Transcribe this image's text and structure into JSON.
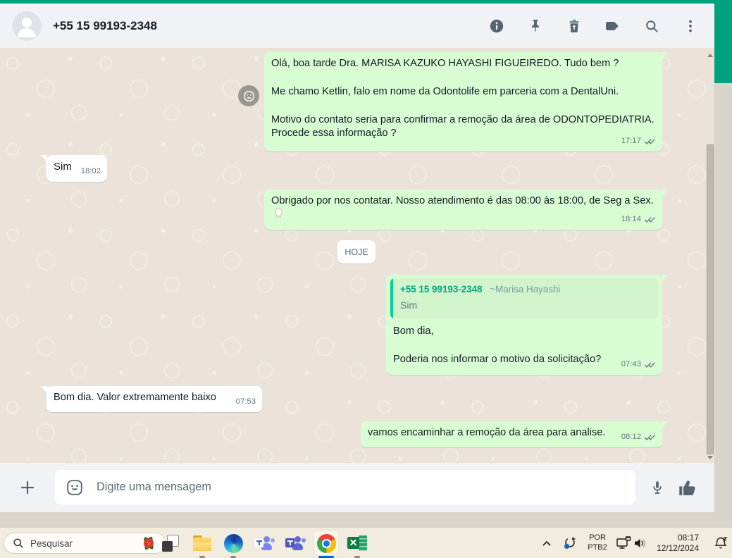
{
  "colors": {
    "accent_teal": "#00a17d",
    "outgoing_bubble": "#d9fdd3",
    "incoming_bubble": "#ffffff",
    "chat_background": "#ebe3d9",
    "panel_background": "#f0f2f5",
    "icon_gray": "#54656f",
    "meta_gray": "#667781",
    "quote_bar": "#06cf9c",
    "quote_author_green": "#00a884",
    "taskbar_background": "#f2ecde",
    "active_app_underline": "#0067c0"
  },
  "header": {
    "title": "+55 15 99193-2348",
    "icons": [
      "info-icon",
      "pin-icon",
      "delete-icon",
      "label-icon",
      "search-icon",
      "menu-icon"
    ]
  },
  "chat": {
    "date_divider": "HOJE",
    "messages": [
      {
        "direction": "out",
        "lines": [
          "Olá, boa tarde Dra. MARISA KAZUKO HAYASHI FIGUEIREDO. Tudo bem ?",
          "Me chamo Ketlin, falo em nome da Odontolife em parceria com a DentalUni.",
          "Motivo do contato seria para confirmar a remoção da área de ODONTOPEDIATRIA. Procede essa informação ?"
        ],
        "time": "17:17",
        "status": "delivered"
      },
      {
        "direction": "in",
        "text": "Sim",
        "time": "18:02"
      },
      {
        "direction": "out",
        "text": "Obrigado por nos contatar. Nosso atendimento é das 08:00 às 18:00, de Seg a Sex.",
        "emoji": "🦷",
        "time": "18:14",
        "status": "delivered"
      },
      {
        "direction": "out",
        "quote": {
          "author": "+55 15 99193-2348",
          "author_name": "~Marisa Hayashi",
          "text": "Sim"
        },
        "lines": [
          "Bom dia,",
          "Poderia nos informar o motivo da solicitação?"
        ],
        "time": "07:43",
        "status": "delivered"
      },
      {
        "direction": "in",
        "text": "Bom dia. Valor extremamente baixo",
        "time": "07:53"
      },
      {
        "direction": "out",
        "text": "vamos encaminhar a remoção da área para analise.",
        "time": "08:12",
        "status": "delivered"
      }
    ]
  },
  "composer": {
    "placeholder": "Digite uma mensagem"
  },
  "taskbar": {
    "search_label": "Pesquisar",
    "apps": [
      "task-view",
      "file-explorer",
      "edge",
      "teams-classic",
      "teams",
      "chrome",
      "excel"
    ],
    "active_app": "chrome",
    "tray": {
      "language_line1": "POR",
      "language_line2": "PTB2",
      "time": "08:17",
      "date": "12/12/2024"
    }
  }
}
